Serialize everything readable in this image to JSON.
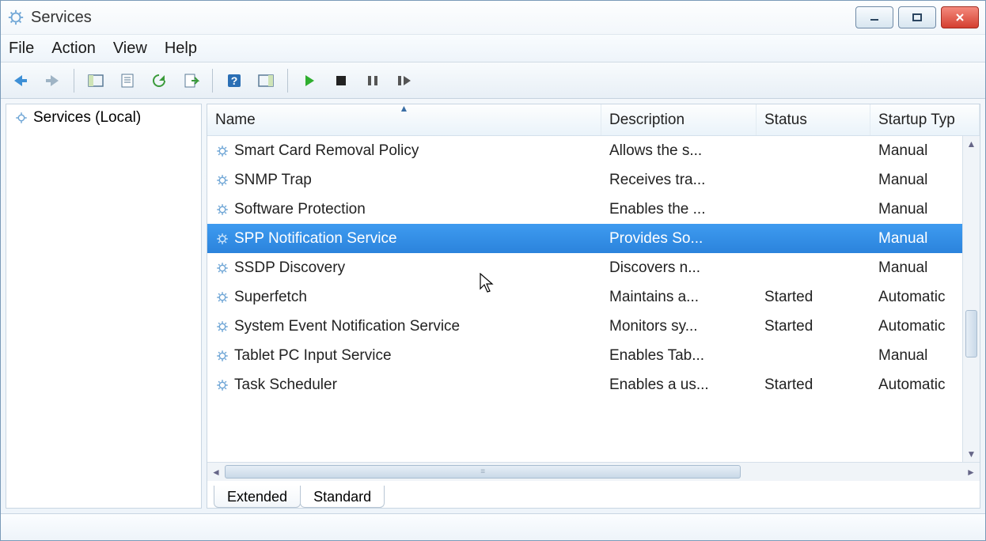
{
  "window": {
    "title": "Services"
  },
  "menu": {
    "file": "File",
    "action": "Action",
    "view": "View",
    "help": "Help"
  },
  "tree": {
    "root": "Services (Local)"
  },
  "columns": {
    "name": "Name",
    "description": "Description",
    "status": "Status",
    "startup_type": "Startup Typ"
  },
  "tabs": {
    "extended": "Extended",
    "standard": "Standard"
  },
  "services": [
    {
      "name": "Smart Card Removal Policy",
      "description": "Allows the s...",
      "status": "",
      "startup_type": "Manual",
      "selected": false
    },
    {
      "name": "SNMP Trap",
      "description": "Receives tra...",
      "status": "",
      "startup_type": "Manual",
      "selected": false
    },
    {
      "name": "Software Protection",
      "description": "Enables the ...",
      "status": "",
      "startup_type": "Manual",
      "selected": false
    },
    {
      "name": "SPP Notification Service",
      "description": "Provides So...",
      "status": "",
      "startup_type": "Manual",
      "selected": true
    },
    {
      "name": "SSDP Discovery",
      "description": "Discovers n...",
      "status": "",
      "startup_type": "Manual",
      "selected": false
    },
    {
      "name": "Superfetch",
      "description": "Maintains a...",
      "status": "Started",
      "startup_type": "Automatic",
      "selected": false
    },
    {
      "name": "System Event Notification Service",
      "description": "Monitors sy...",
      "status": "Started",
      "startup_type": "Automatic",
      "selected": false
    },
    {
      "name": "Tablet PC Input Service",
      "description": "Enables Tab...",
      "status": "",
      "startup_type": "Manual",
      "selected": false
    },
    {
      "name": "Task Scheduler",
      "description": "Enables a us...",
      "status": "Started",
      "startup_type": "Automatic",
      "selected": false
    }
  ]
}
